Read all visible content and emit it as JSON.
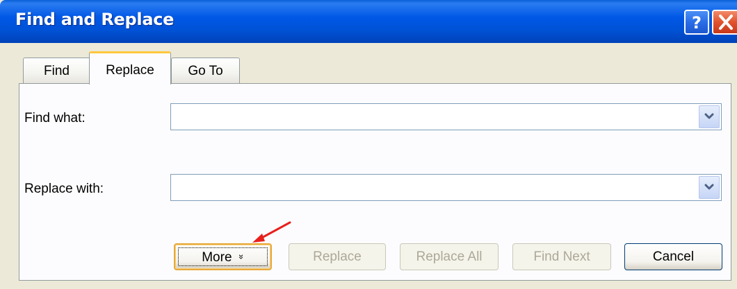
{
  "window": {
    "title": "Find and Replace",
    "help_icon": "question-mark-icon",
    "close_icon": "close-icon",
    "accent_color": "#0058E6",
    "close_color": "#E0532D"
  },
  "tabs": [
    {
      "label": "Find",
      "selected": false
    },
    {
      "label": "Replace",
      "selected": true
    },
    {
      "label": "Go To",
      "selected": false
    }
  ],
  "find_what": {
    "label": "Find what:",
    "value": "",
    "placeholder": ""
  },
  "replace_with": {
    "label": "Replace with:",
    "value": "",
    "placeholder": ""
  },
  "buttons": {
    "more": "More",
    "more_arrow": "»",
    "replace": "Replace",
    "replace_all": "Replace All",
    "find_next": "Find Next",
    "cancel": "Cancel"
  },
  "annotation": {
    "arrow_color": "#E8201C",
    "icon": "red-arrow-icon"
  }
}
